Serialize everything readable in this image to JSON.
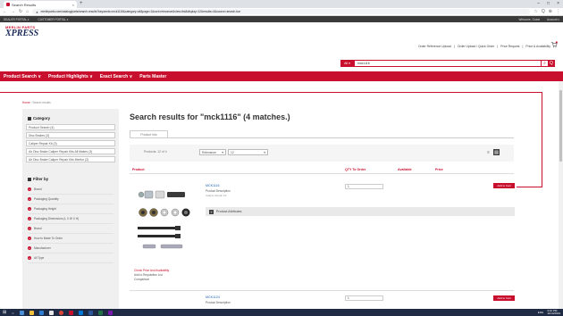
{
  "browser": {
    "tab_title": "Search Results",
    "tab_close": "×",
    "new_tab": "+",
    "url": "merlinparts.com/catalog/parts/search-results?keywords=mck1116&category=all&page=1&sort=relevance&view=list&display=12&results=4&source=search-bar",
    "nav_back": "←",
    "nav_forward": "→",
    "nav_reload": "↻",
    "nav_home": "⌂",
    "lock": "●",
    "ext_icons": [
      "☆",
      "Q",
      "⊕",
      "⋮"
    ],
    "win_min": "–",
    "win_max": "□",
    "win_close": "×"
  },
  "utilbar": {
    "left1": "DEALER PORTAL ▾",
    "left2": "CUSTOMER PORTAL ▾",
    "right1": "Welcome, Guest",
    "right2": "Account ▾"
  },
  "header": {
    "logo_top": "MERLIN PARTS",
    "logo_main": "XPRESS",
    "toplinks": [
      "Order Reference Upload",
      "Order Upload / Quick Order",
      "Price Request",
      "Price & Availability"
    ],
    "sep": "|",
    "search_scope": "All",
    "search_value": "mck1116",
    "camera_icon": "⌕",
    "search_icon": "Q"
  },
  "mainnav": {
    "items": [
      "Product Search ∨",
      "Product Highlights ∨",
      "Exact Search ∨",
      "Parts Master"
    ]
  },
  "breadcrumb": {
    "home": "Home",
    "sep": " › ",
    "current": "Search results"
  },
  "sidebar": {
    "category_title": "Category",
    "categories": [
      "Product Search (4)",
      "Disc Brakes (3)",
      "Caliper Repair Kit (3)",
      "Air Disc Brake Caliper Repair Kits All Makes (3)",
      "Air Disc Brake Caliper Repair Kits Meritor (2)"
    ],
    "filter_title": "Filter by",
    "filters": [
      "Brand",
      "Packaging Quantity",
      "Packaging Height",
      "Packaging Dimensions (L X W X H)",
      "Brand",
      "How to Made To Order",
      "Manufacturer",
      "All Type"
    ]
  },
  "results": {
    "title": "Search results for \"mck1116\" (4 matches.)",
    "subtab": "Product Info",
    "per_page_label": "Products: 12 of 4",
    "sort_value": "Relevance",
    "per_page_value": "12",
    "view_grid": "≡",
    "view_list": "▤",
    "columns": {
      "product": "Product",
      "qty": "QTY To Order",
      "available": "Available",
      "price": "Price"
    }
  },
  "products": [
    {
      "number": "MCK1116",
      "desc": "Product Description",
      "sub": "Caliper Repair Kit",
      "qty": "1",
      "add": "Add to Cart",
      "attr_plus": "+",
      "attr_label": "Product Attributes",
      "avail_line1": "Check Price And Availability",
      "avail_line2": "Add to Requisition List",
      "avail_line3": "Comparison"
    },
    {
      "number": "MCK1124",
      "desc": "Product Description",
      "qty": "1",
      "add": "Add to Cart"
    }
  ],
  "taskbar": {
    "time": "3:42 PM",
    "date": "11/14/2019",
    "lang": "ENG"
  },
  "colors": {
    "brand_red": "#c8102e",
    "navy": "#1a2a5a",
    "taskbar": "#1f2a44"
  }
}
